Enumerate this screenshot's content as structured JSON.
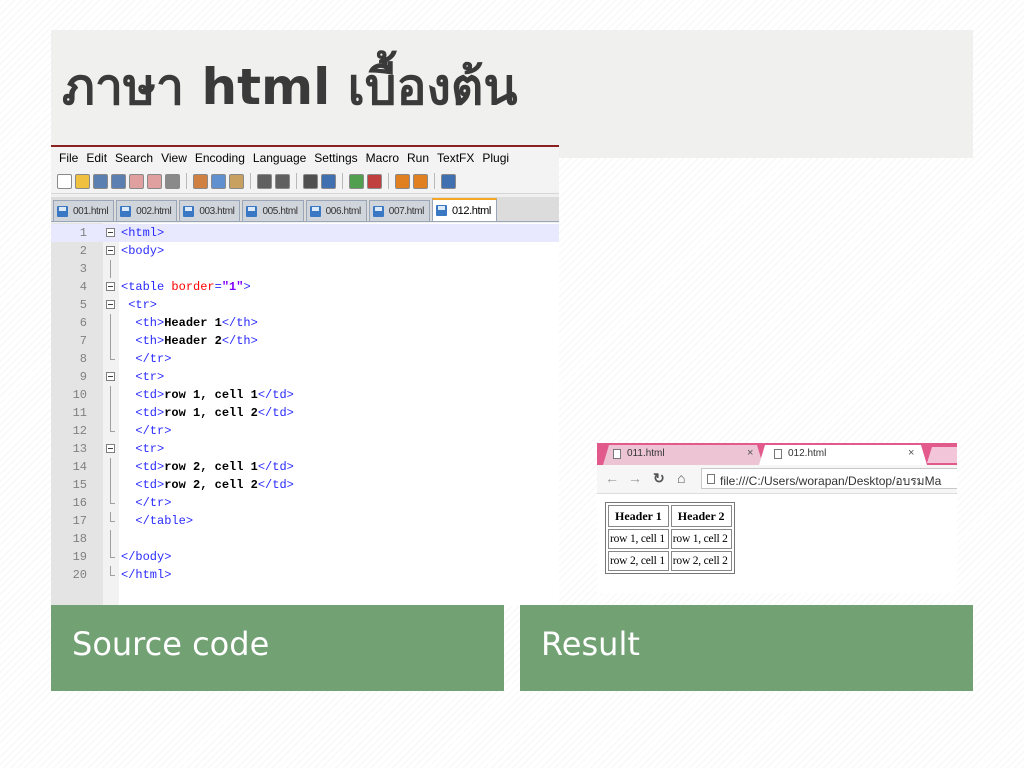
{
  "slide": {
    "title": "ภาษา html เบื้องต้น",
    "caption_left": "Source code",
    "caption_right": "Result",
    "colors": {
      "caption_bg": "#72a174",
      "title_band": "#f0f0ee",
      "title_text": "#3a3a3a"
    }
  },
  "editor": {
    "menu": [
      "File",
      "Edit",
      "Search",
      "View",
      "Encoding",
      "Language",
      "Settings",
      "Macro",
      "Run",
      "TextFX",
      "Plugi"
    ],
    "toolbar_icons": [
      "new-file-icon",
      "open-folder-icon",
      "save-icon",
      "save-all-icon",
      "close-icon",
      "close-all-icon",
      "print-icon",
      "cut-icon",
      "copy-icon",
      "paste-icon",
      "undo-icon",
      "redo-icon",
      "find-icon",
      "replace-icon",
      "zoom-in-icon",
      "zoom-out-icon",
      "sync-v-icon",
      "sync-h-icon",
      "word-wrap-icon"
    ],
    "tabs": [
      {
        "label": "001.html",
        "active": false
      },
      {
        "label": "002.html",
        "active": false
      },
      {
        "label": "003.html",
        "active": false
      },
      {
        "label": "005.html",
        "active": false
      },
      {
        "label": "006.html",
        "active": false
      },
      {
        "label": "007.html",
        "active": false
      },
      {
        "label": "012.html",
        "active": true
      }
    ],
    "lines": [
      {
        "n": "1",
        "fold": "box",
        "segs": [
          [
            "tg",
            "<html>"
          ]
        ]
      },
      {
        "n": "2",
        "fold": "box",
        "segs": [
          [
            "tg",
            "<body>"
          ]
        ]
      },
      {
        "n": "3",
        "fold": "line",
        "segs": []
      },
      {
        "n": "4",
        "fold": "box",
        "segs": [
          [
            "tg",
            "<table "
          ],
          [
            "at",
            "border"
          ],
          [
            "tg",
            "="
          ],
          [
            "av",
            "\"1\""
          ],
          [
            "tg",
            ">"
          ]
        ]
      },
      {
        "n": "5",
        "fold": "box",
        "segs": [
          [
            "tx",
            " "
          ],
          [
            "tg",
            "<tr>"
          ]
        ]
      },
      {
        "n": "6",
        "fold": "line",
        "segs": [
          [
            "tx",
            "  "
          ],
          [
            "tg",
            "<th>"
          ],
          [
            "tx",
            "Header 1"
          ],
          [
            "tg",
            "</th>"
          ]
        ]
      },
      {
        "n": "7",
        "fold": "line",
        "segs": [
          [
            "tx",
            "  "
          ],
          [
            "tg",
            "<th>"
          ],
          [
            "tx",
            "Header 2"
          ],
          [
            "tg",
            "</th>"
          ]
        ]
      },
      {
        "n": "8",
        "fold": "end",
        "segs": [
          [
            "tx",
            "  "
          ],
          [
            "tg",
            "</tr>"
          ]
        ]
      },
      {
        "n": "9",
        "fold": "box",
        "segs": [
          [
            "tx",
            "  "
          ],
          [
            "tg",
            "<tr>"
          ]
        ]
      },
      {
        "n": "10",
        "fold": "line",
        "segs": [
          [
            "tx",
            "  "
          ],
          [
            "tg",
            "<td>"
          ],
          [
            "tx",
            "row 1, cell 1"
          ],
          [
            "tg",
            "</td>"
          ]
        ]
      },
      {
        "n": "11",
        "fold": "line",
        "segs": [
          [
            "tx",
            "  "
          ],
          [
            "tg",
            "<td>"
          ],
          [
            "tx",
            "row 1, cell 2"
          ],
          [
            "tg",
            "</td>"
          ]
        ]
      },
      {
        "n": "12",
        "fold": "end",
        "segs": [
          [
            "tx",
            "  "
          ],
          [
            "tg",
            "</tr>"
          ]
        ]
      },
      {
        "n": "13",
        "fold": "box",
        "segs": [
          [
            "tx",
            "  "
          ],
          [
            "tg",
            "<tr>"
          ]
        ]
      },
      {
        "n": "14",
        "fold": "line",
        "segs": [
          [
            "tx",
            "  "
          ],
          [
            "tg",
            "<td>"
          ],
          [
            "tx",
            "row 2, cell 1"
          ],
          [
            "tg",
            "</td>"
          ]
        ]
      },
      {
        "n": "15",
        "fold": "line",
        "segs": [
          [
            "tx",
            "  "
          ],
          [
            "tg",
            "<td>"
          ],
          [
            "tx",
            "row 2, cell 2"
          ],
          [
            "tg",
            "</td>"
          ]
        ]
      },
      {
        "n": "16",
        "fold": "end",
        "segs": [
          [
            "tx",
            "  "
          ],
          [
            "tg",
            "</tr>"
          ]
        ]
      },
      {
        "n": "17",
        "fold": "end",
        "segs": [
          [
            "tx",
            "  "
          ],
          [
            "tg",
            "</table>"
          ]
        ]
      },
      {
        "n": "18",
        "fold": "line",
        "segs": []
      },
      {
        "n": "19",
        "fold": "end",
        "segs": [
          [
            "tg",
            "</body>"
          ]
        ]
      },
      {
        "n": "20",
        "fold": "end",
        "segs": [
          [
            "tg",
            "</html>"
          ]
        ]
      }
    ]
  },
  "browser": {
    "tab1_label": "011.html",
    "tab2_label": "012.html",
    "close_glyph": "×",
    "url": "file:///C:/Users/worapan/Desktop/อบรมMa",
    "table": {
      "headers": [
        "Header 1",
        "Header 2"
      ],
      "rows": [
        [
          "row 1, cell 1",
          "row 1, cell 2"
        ],
        [
          "row 2, cell 1",
          "row 2, cell 2"
        ]
      ]
    }
  }
}
